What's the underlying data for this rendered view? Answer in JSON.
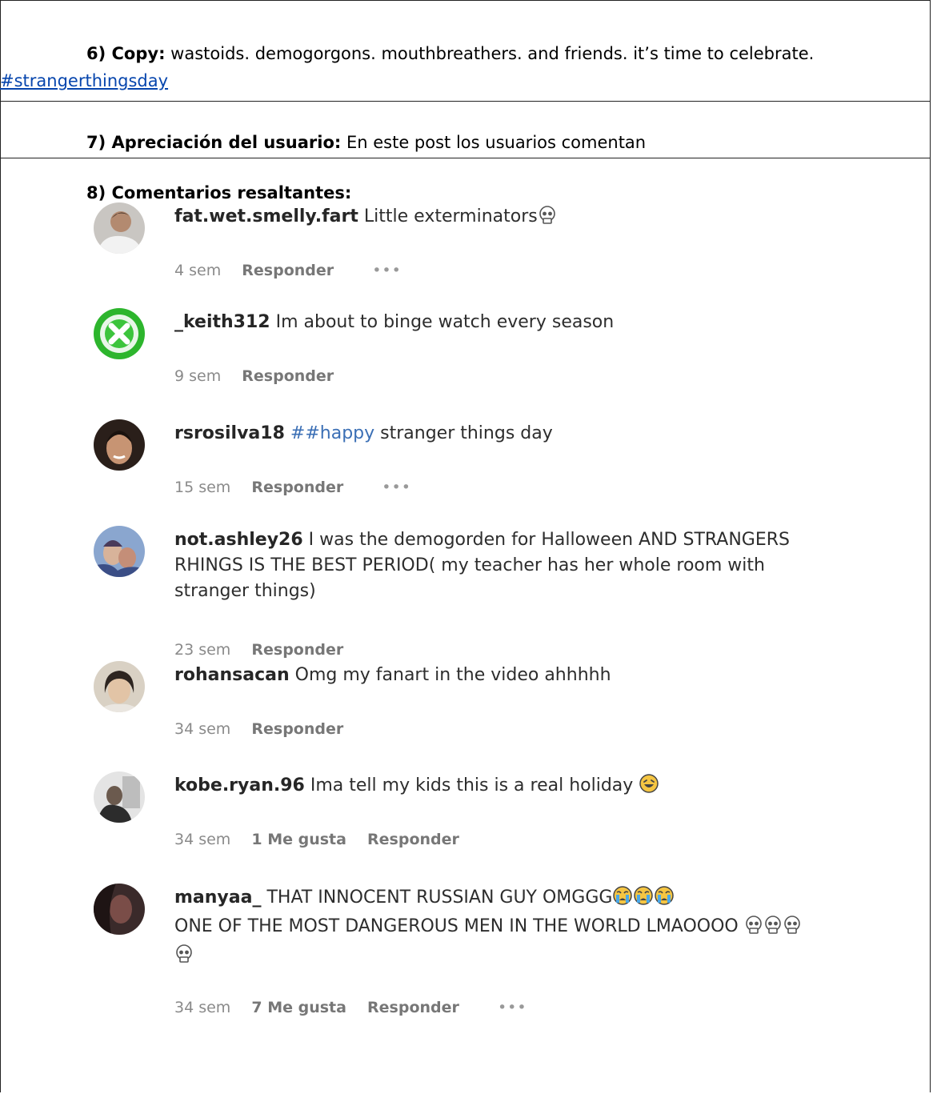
{
  "copy": {
    "label": "6) Copy:",
    "text": "wastoids. demogorgons. mouthbreathers. and friends. it’s time to celebrate.",
    "hashtag": "#strangerthingsday"
  },
  "appreciation": {
    "label": "7) Apreciación del usuario:",
    "text": "En este post los usuarios comentan"
  },
  "comments_section": {
    "label": "8) Comentarios resaltantes:"
  },
  "comments": [
    {
      "user": "fat.wet.smelly.fart",
      "text": "Little exterminators",
      "emojis": [
        "skull"
      ],
      "time": "4 sem",
      "likes": "",
      "reply": "Responder",
      "more": "•••"
    },
    {
      "user": "_keith312",
      "text": "Im about to binge watch every season",
      "emojis": [],
      "time": "9 sem",
      "likes": "",
      "reply": "Responder",
      "more": ""
    },
    {
      "user": "rsrosilva18",
      "pre": "##",
      "link": "happy",
      "text": "stranger things day",
      "emojis": [],
      "time": "15 sem",
      "likes": "",
      "reply": "Responder",
      "more": "•••"
    },
    {
      "user": "not.ashley26",
      "text": "I was the demogorden for Halloween AND STRANGERS RHINGS IS THE BEST PERIOD( my teacher has her whole room with stranger things)",
      "emojis": [],
      "time": "23 sem",
      "likes": "",
      "reply": "Responder",
      "more": ""
    },
    {
      "user": "rohansacan",
      "text": "Omg my fanart in the video ahhhhh",
      "emojis": [],
      "time": "34 sem",
      "likes": "",
      "reply": "Responder",
      "more": ""
    },
    {
      "user": "kobe.ryan.96",
      "text": "Ima tell my kids this is a real holiday",
      "emojis": [
        "laugh"
      ],
      "time": "34 sem",
      "likes": "1 Me gusta",
      "reply": "Responder",
      "more": ""
    },
    {
      "user": "manyaa_",
      "text": "THAT INNOCENT RUSSIAN GUY OMGGG",
      "text2": "ONE OF THE MOST DANGEROUS MEN IN THE WORLD LMAOOOO",
      "emojis": [
        "cry",
        "cry",
        "cry"
      ],
      "emojis2": [
        "skull",
        "skull",
        "skull",
        "skull"
      ],
      "time": "34 sem",
      "likes": "7 Me gusta",
      "reply": "Responder",
      "more": "•••"
    }
  ]
}
